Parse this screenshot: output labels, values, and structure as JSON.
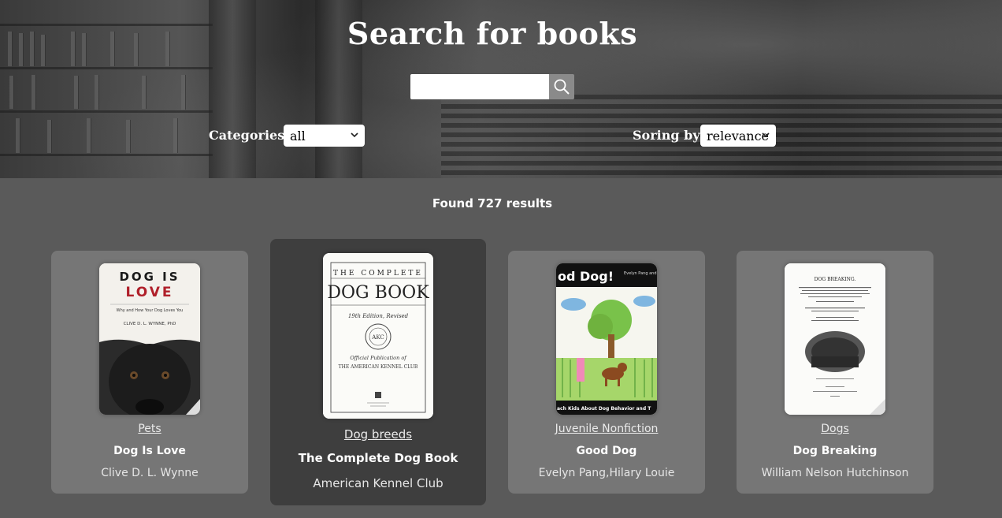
{
  "header": {
    "title": "Search for books",
    "search": {
      "value": "",
      "placeholder": ""
    },
    "categories_label": "Categories",
    "categories_selected": "all",
    "sort_label": "Soring by",
    "sort_selected": "relevance"
  },
  "results": {
    "count_text": "Found 727 results"
  },
  "books": [
    {
      "category": "Pets",
      "title": "Dog Is Love",
      "author": "Clive D. L. Wynne",
      "cover_text": {
        "line1": "DOG IS",
        "line2": "LOVE",
        "subtitle": "Why and How Your Dog Loves You",
        "author": "CLIVE D. L. WYNNE, PhD"
      }
    },
    {
      "category": "Dog breeds",
      "title": "The Complete Dog Book",
      "author": "American Kennel Club",
      "cover_text": {
        "line1": "THE COMPLETE",
        "line2": "DOG BOOK",
        "edition": "19th Edition, Revised",
        "seal": "AKC",
        "line3": "Official Publication of",
        "line4": "THE AMERICAN KENNEL CLUB"
      }
    },
    {
      "category": "Juvenile Nonfiction",
      "title": "Good Dog",
      "author": "Evelyn Pang,Hilary Louie",
      "cover_text": {
        "title": "od Dog!",
        "author": "Evelyn Pang and",
        "bottom": "ach Kids About Dog Behavior and T"
      }
    },
    {
      "category": "Dogs",
      "title": "Dog Breaking",
      "author": "William Nelson Hutchinson",
      "cover_text": {
        "title": "DOG BREAKING."
      }
    }
  ],
  "colors": {
    "card_bg": "#767676",
    "card_active_bg": "#3e3e3e",
    "page_bg": "#5a5a5a",
    "dog_love_red": "#b0202a"
  }
}
